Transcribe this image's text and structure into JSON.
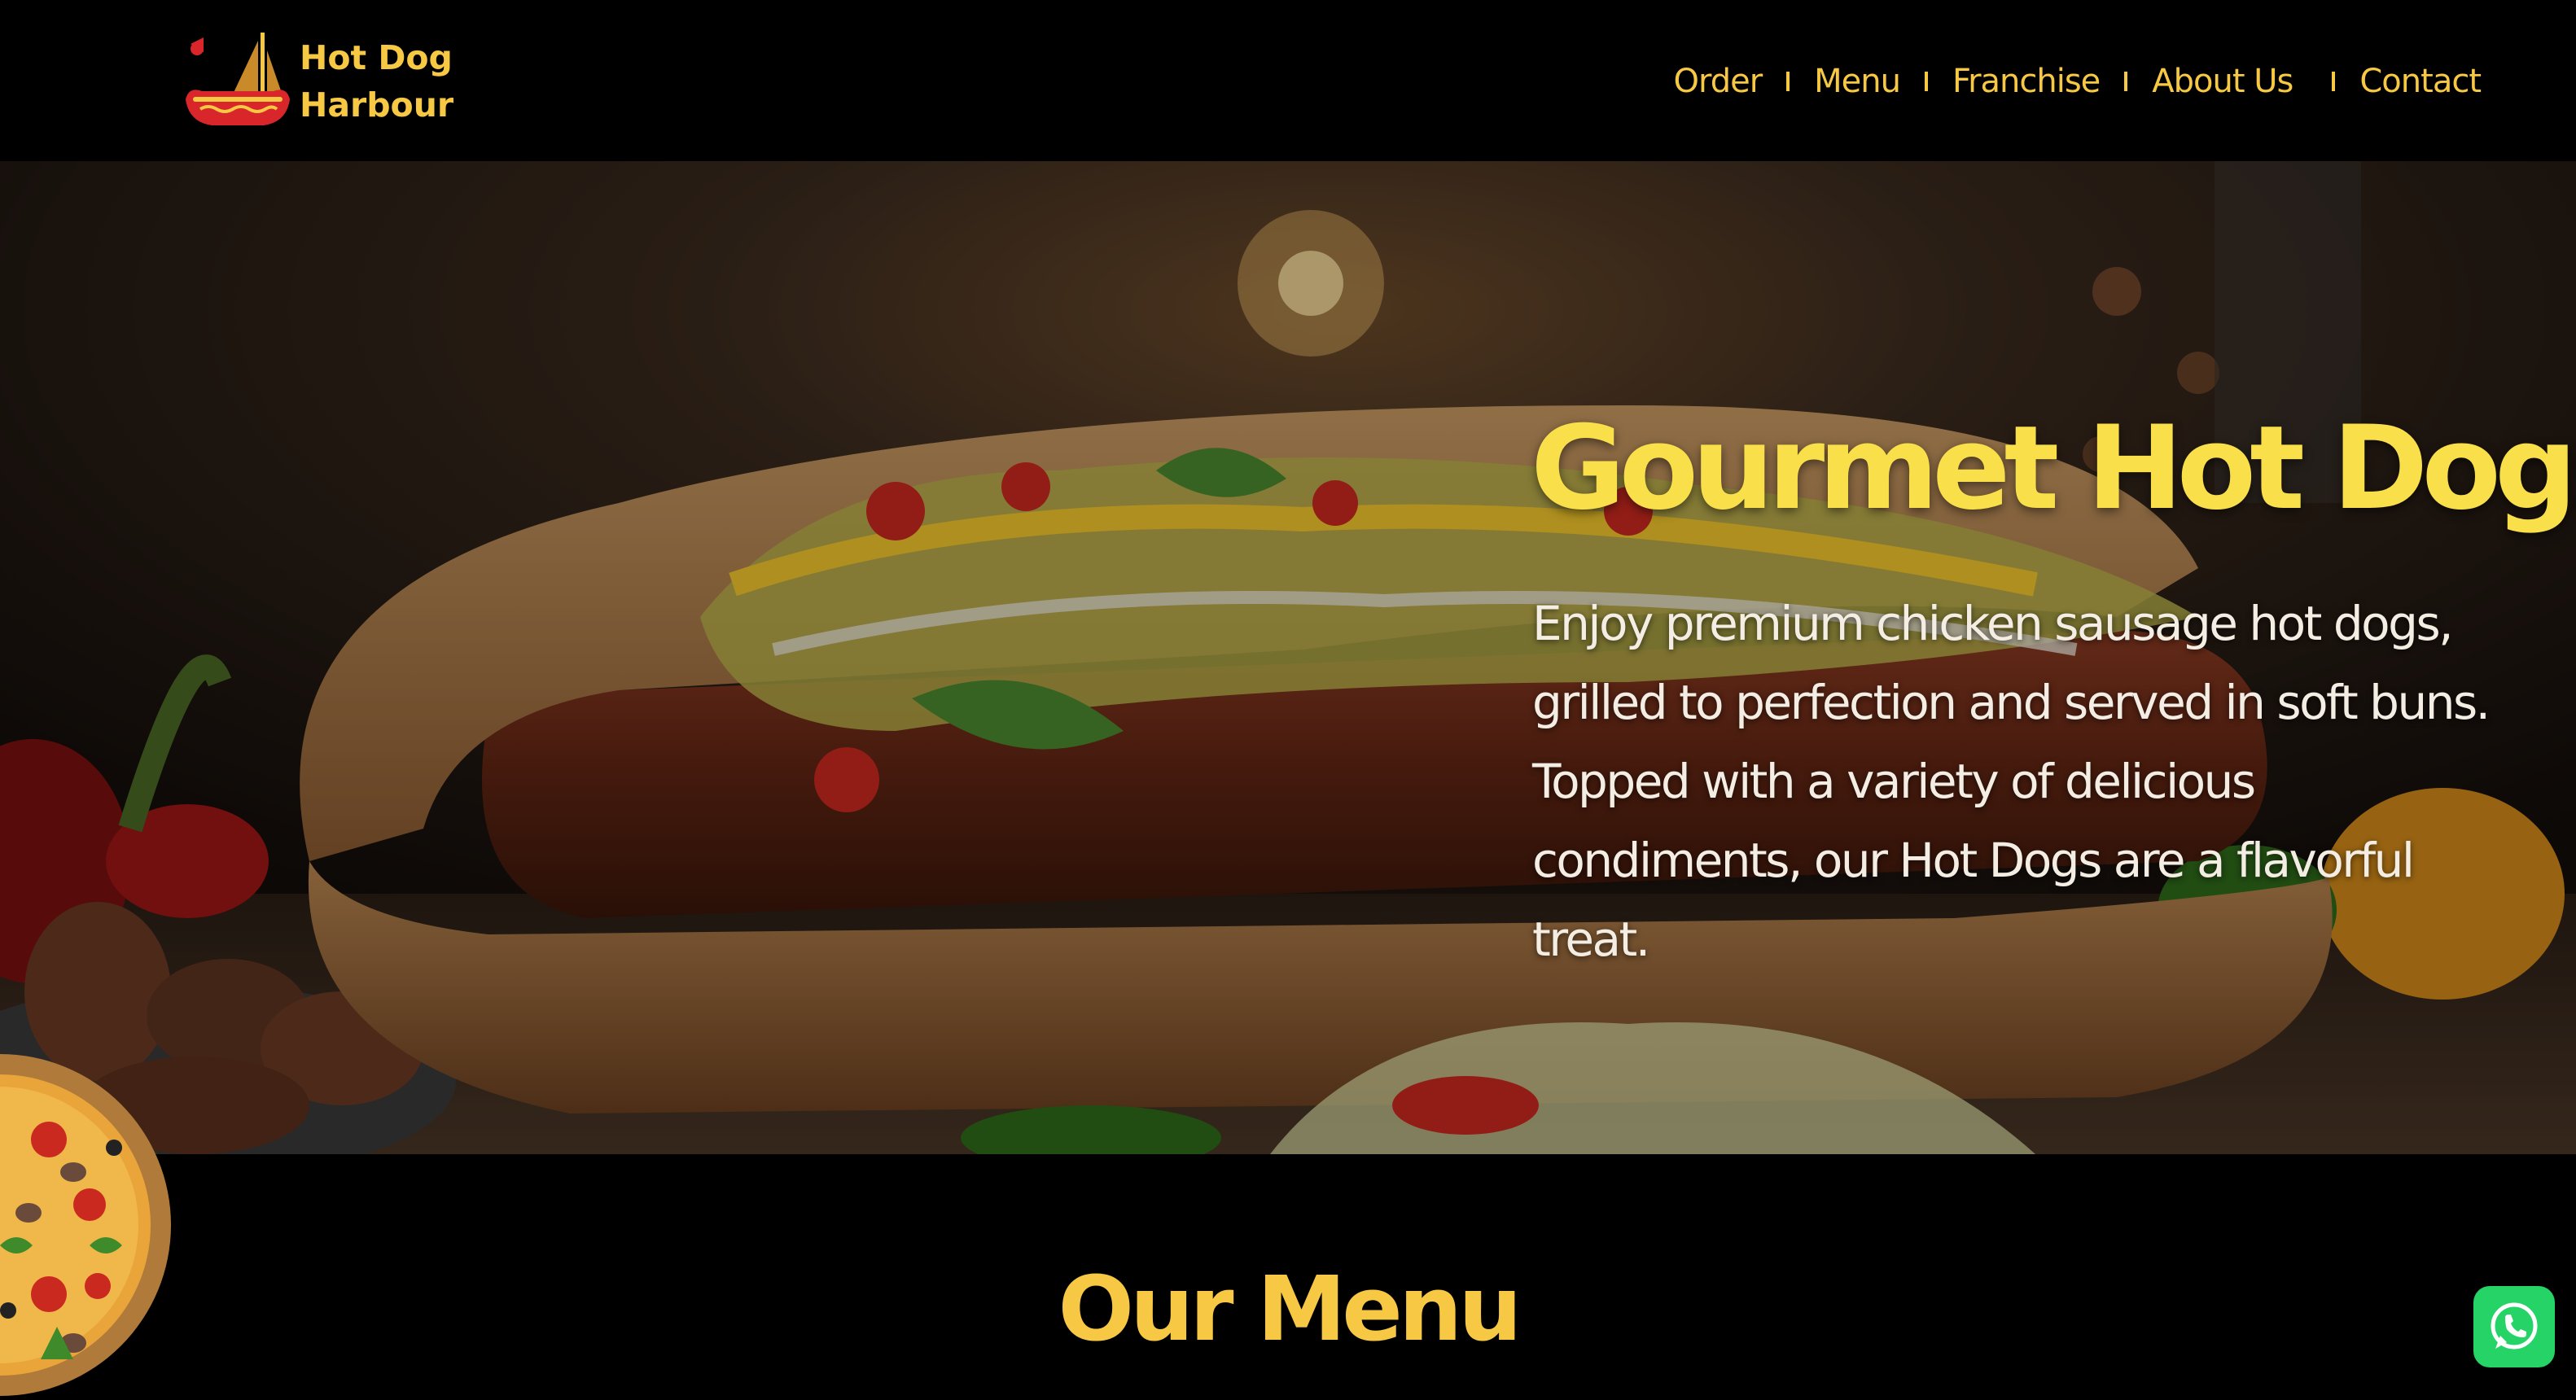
{
  "brand": {
    "line1": "Hot Dog",
    "line2": "Harbour",
    "logo_icon": "hotdog-boat-icon"
  },
  "nav": {
    "items": [
      {
        "label": "Order"
      },
      {
        "label": "Menu"
      },
      {
        "label": "Franchise"
      },
      {
        "label": "About Us"
      },
      {
        "label": "Contact"
      }
    ]
  },
  "hero": {
    "title": "Gourmet Hot Dogs",
    "description": "Enjoy premium chicken sausage hot dogs, grilled to perfection and served in soft buns. Topped with a variety of delicious condiments, our Hot Dogs are a flavorful treat.",
    "image": "hot-dog-photo"
  },
  "menu_section": {
    "title": "Our Menu",
    "decoration": "pizza-image"
  },
  "floating": {
    "icon": "whatsapp-icon"
  },
  "colors": {
    "accent": "#f7c843",
    "hero_title": "#f9e04b",
    "background": "#000000",
    "whatsapp": "#25d366"
  }
}
